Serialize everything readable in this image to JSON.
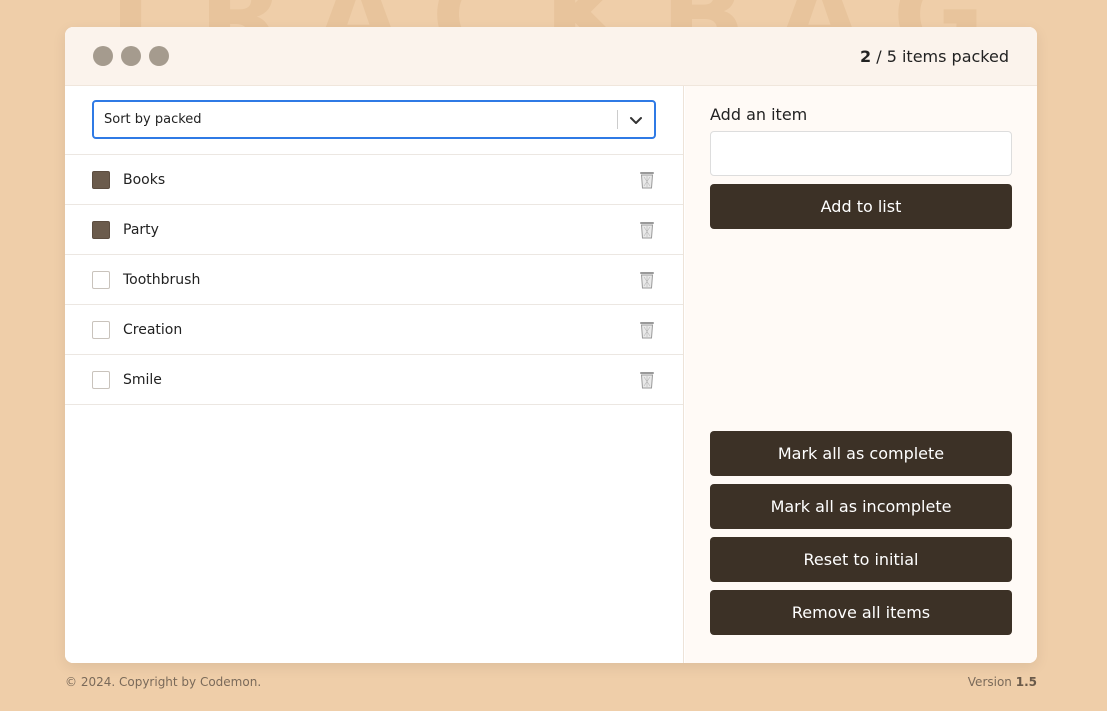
{
  "watermark": "TRACKBAG",
  "header": {
    "packed_count": "2",
    "counter_rest": " / 5 items packed"
  },
  "sort": {
    "selected": "Sort by packed"
  },
  "items": [
    {
      "label": "Books",
      "packed": true
    },
    {
      "label": "Party",
      "packed": true
    },
    {
      "label": "Toothbrush",
      "packed": false
    },
    {
      "label": "Creation",
      "packed": false
    },
    {
      "label": "Smile",
      "packed": false
    }
  ],
  "add": {
    "title": "Add an item",
    "input_value": "",
    "button": "Add to list"
  },
  "actions": {
    "mark_complete": "Mark all as complete",
    "mark_incomplete": "Mark all as incomplete",
    "reset": "Reset to initial",
    "remove_all": "Remove all items"
  },
  "footer": {
    "copyright": "© 2024. Copyright by Codemon.",
    "version_label": "Version ",
    "version_number": "1.5"
  },
  "colors": {
    "background": "#efcea9",
    "button": "#3c3126",
    "checked": "#6b5b4c",
    "focus": "#2f7ae5"
  }
}
